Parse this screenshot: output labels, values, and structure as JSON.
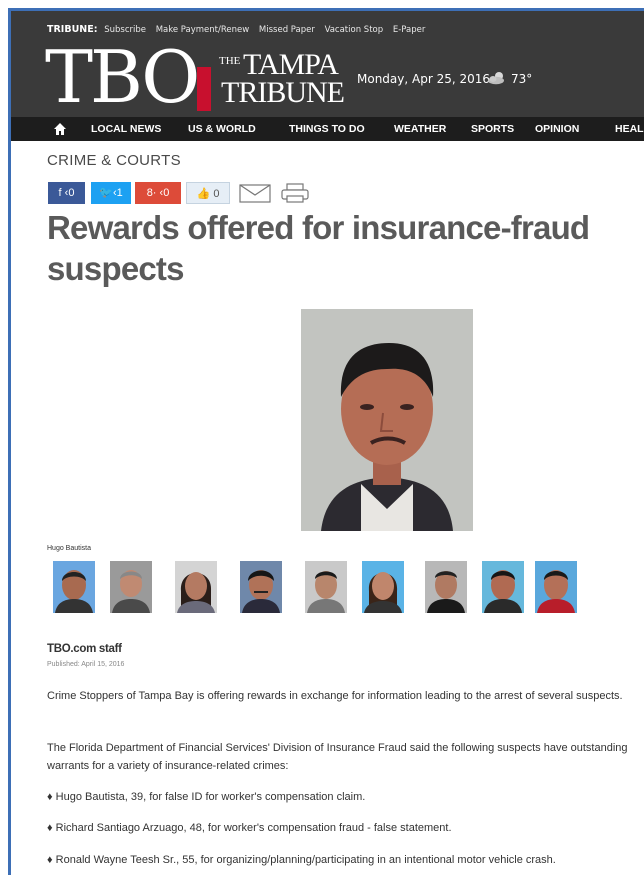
{
  "header": {
    "brand": "TRIBUNE:",
    "links": [
      "Subscribe",
      "Make Payment/Renew",
      "Missed Paper",
      "Vacation Stop",
      "E-Paper"
    ],
    "logo_text": "TBO",
    "logo_the": "THE",
    "logo_tampa": "TAMPA",
    "logo_tribune": "TRIBUNE",
    "date": "Monday, Apr 25, 2016",
    "weather_icon": "cloud-sun-icon",
    "temperature": "73°"
  },
  "nav": {
    "home_icon": "home-icon",
    "items": [
      "LOCAL NEWS",
      "US & WORLD",
      "THINGS TO DO",
      "WEATHER",
      "SPORTS",
      "OPINION",
      "HEAL"
    ]
  },
  "article": {
    "section": "CRIME & COURTS",
    "share": {
      "facebook": "f ‹0",
      "twitter": "🐦‹1",
      "googleplus": "8· ‹0",
      "like": "0",
      "mail_icon": "mail-icon",
      "print_icon": "print-icon"
    },
    "headline": "Rewards offered for insurance-fraud suspects",
    "photo_caption": "Hugo Bautista",
    "thumbnails": [
      "suspect-1",
      "suspect-2",
      "suspect-3",
      "suspect-4",
      "suspect-5",
      "suspect-6",
      "suspect-7",
      "suspect-8",
      "suspect-9"
    ],
    "byline": "TBO.com staff",
    "published": "Published: April 15, 2016",
    "paragraphs": [
      "Crime Stoppers of Tampa Bay is offering rewards in exchange for information leading to the arrest of several suspects.",
      "The Florida Department of Financial Services' Division of Insurance Fraud said the following suspects have outstanding warrants for a variety of insurance-related crimes:"
    ],
    "bullets": [
      "♦ Hugo Bautista, 39, for false ID for worker's compensation claim.",
      "♦ Richard Santiago Arzuago, 48, for worker's compensation fraud - false statement.",
      "♦ Ronald Wayne Teesh Sr., 55, for organizing/planning/participating in an intentional motor vehicle crash."
    ]
  },
  "colors": {
    "header_bg": "#3a3a3a",
    "nav_bg": "#1d1d1d",
    "accent_red": "#c8102e",
    "facebook": "#3b5998",
    "twitter": "#1da1f2",
    "googleplus": "#dd4b39"
  }
}
